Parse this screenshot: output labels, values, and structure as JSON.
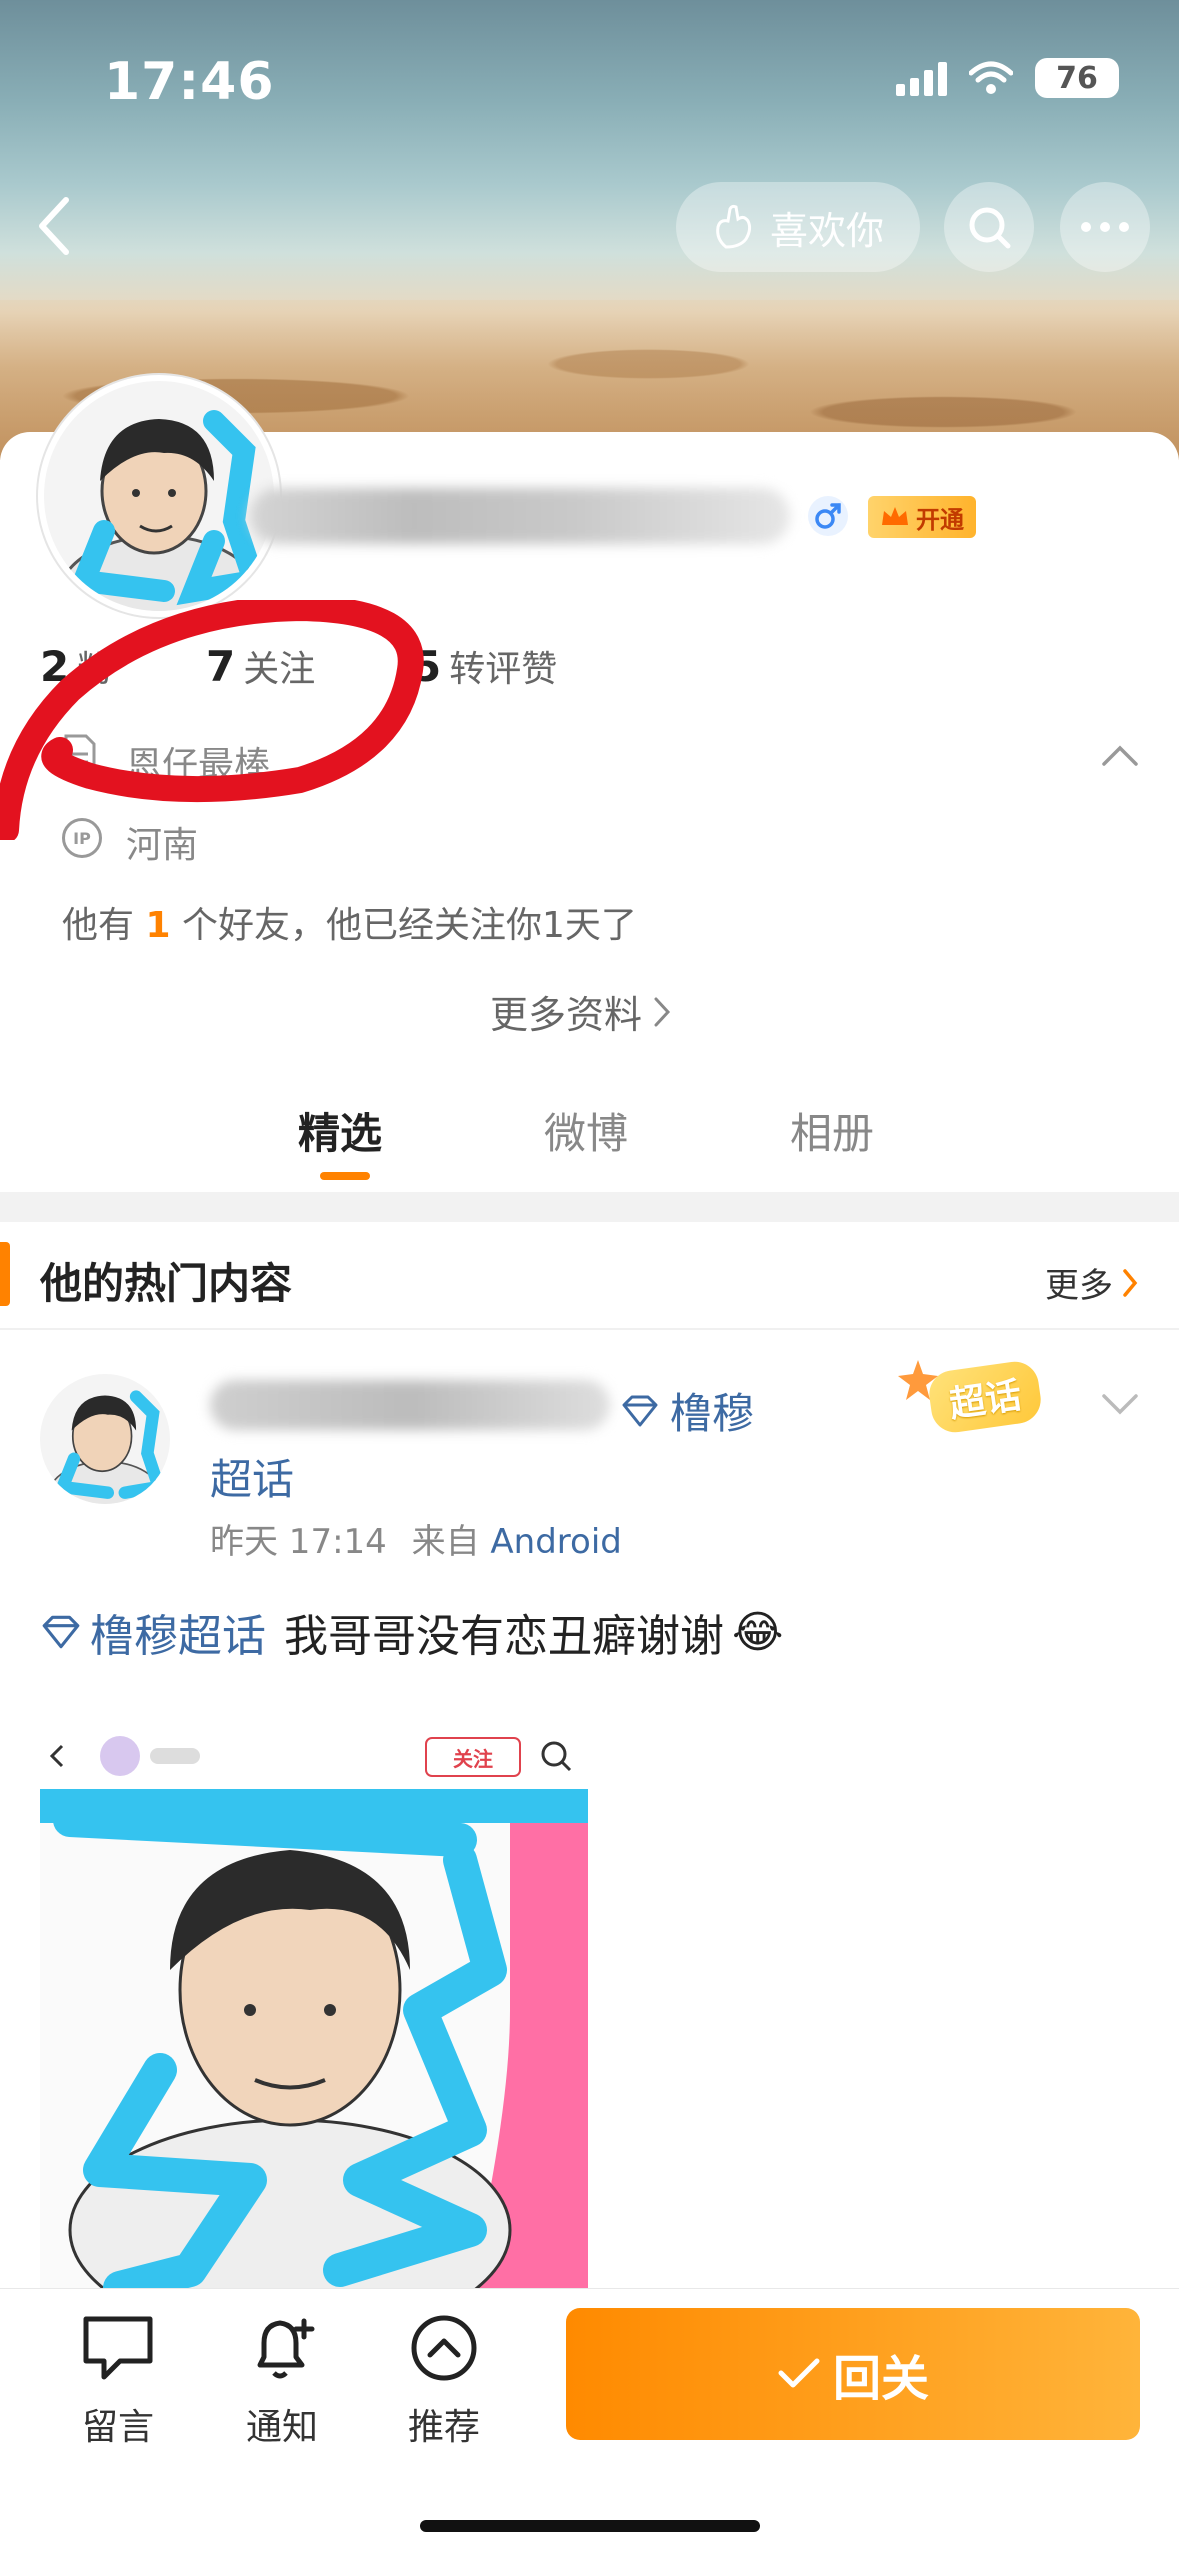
{
  "status_bar": {
    "time": "17:46",
    "battery": "76"
  },
  "header": {
    "like_you_label": "喜欢你"
  },
  "profile": {
    "vip_label": "开通",
    "stats": [
      {
        "num": "2",
        "label": "粉"
      },
      {
        "num": "7",
        "label": "关注"
      },
      {
        "num": "5",
        "label": "转评赞"
      }
    ],
    "bio": "恩仔最棒",
    "ip_badge": "IP",
    "location": "河南",
    "friend_text_pre": "他有",
    "friend_count": "1",
    "friend_text_post": "个好友，他已经关注你1天了",
    "more_info": "更多资料"
  },
  "tabs": [
    {
      "label": "精选",
      "active": true
    },
    {
      "label": "微博",
      "active": false
    },
    {
      "label": "相册",
      "active": false
    }
  ],
  "section": {
    "title": "他的热门内容",
    "more": "更多"
  },
  "post": {
    "topic_tag": "橹穆",
    "topic_tag2": "超话",
    "time": "昨天 17:14",
    "source_pre": "来自",
    "source": "Android",
    "badge": "超话",
    "content_tag": "橹穆超话",
    "content_text": "我哥哥没有恋丑癖谢谢",
    "emoji": "😂",
    "inner_follow": "关注"
  },
  "bottom_bar": {
    "items": [
      {
        "label": "留言"
      },
      {
        "label": "通知"
      },
      {
        "label": "推荐"
      }
    ],
    "follow_back": "回关"
  }
}
